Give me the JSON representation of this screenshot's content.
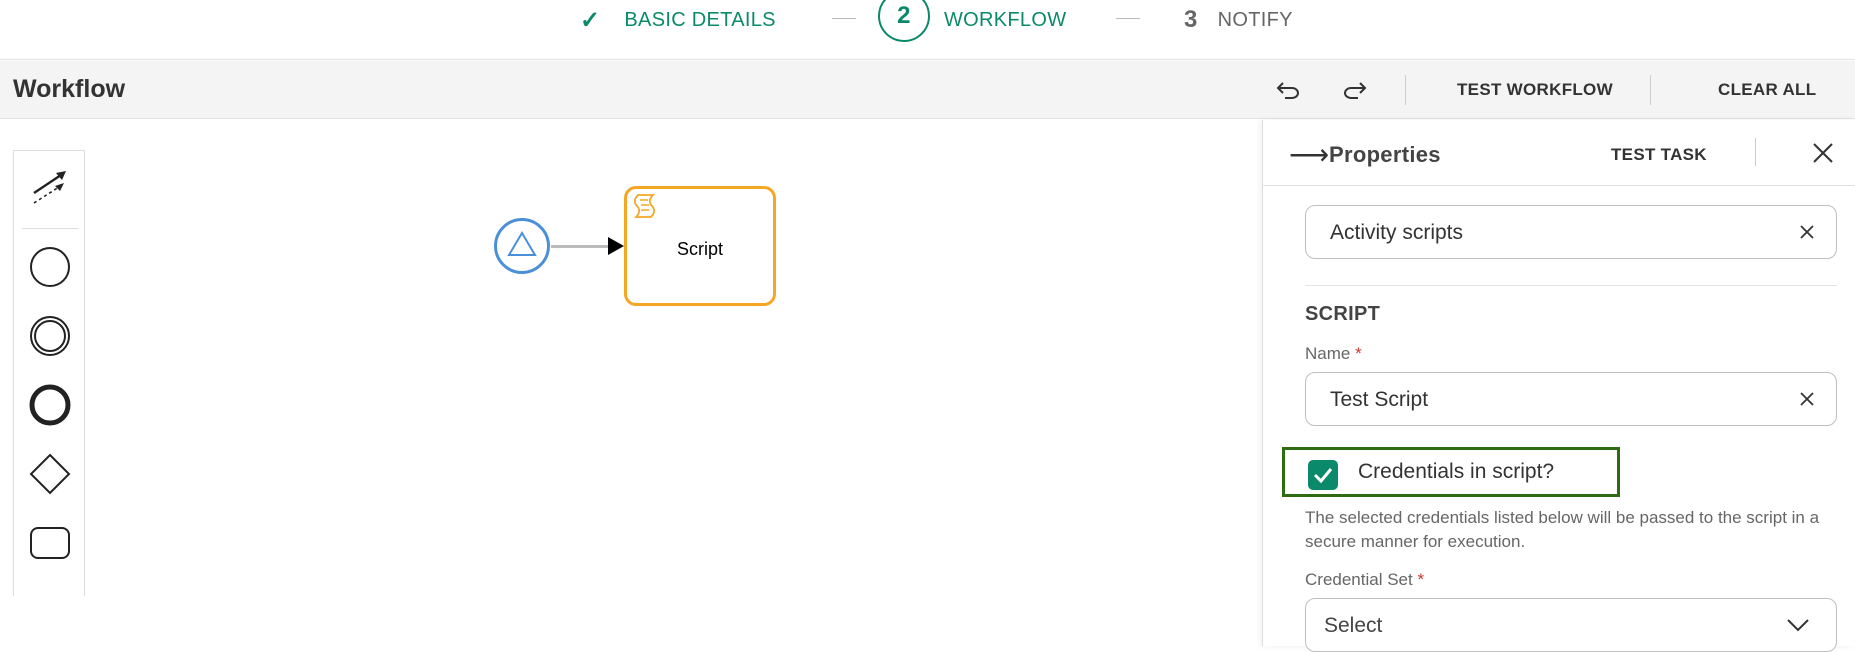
{
  "stepper": {
    "steps": [
      {
        "label": "BASIC DETAILS",
        "state": "done"
      },
      {
        "number": "2",
        "label": "WORKFLOW",
        "state": "active"
      },
      {
        "number": "3",
        "label": "NOTIFY",
        "state": "idle"
      }
    ]
  },
  "header": {
    "title": "Workflow",
    "undo_icon": "undo-icon",
    "redo_icon": "redo-icon",
    "test_workflow": "TEST WORKFLOW",
    "clear_all": "CLEAR ALL"
  },
  "palette": {
    "items": [
      "connect-tool-icon",
      "start-event-icon",
      "intermediate-event-icon",
      "end-event-icon",
      "gateway-icon",
      "task-icon"
    ]
  },
  "diagram": {
    "script_task_label": "Script"
  },
  "properties": {
    "title": "Properties",
    "test_task": "TEST TASK",
    "type_value": "Activity scripts",
    "section_title": "SCRIPT",
    "name_label": "Name",
    "name_required": "*",
    "name_value": "Test Script",
    "credentials_checkbox_label": "Credentials in script?",
    "credentials_checked": true,
    "credentials_help": "The selected credentials listed below will be passed to the script in a secure manner for execution.",
    "credential_set_label": "Credential Set",
    "credential_set_required": "*",
    "credential_set_value": "Select"
  },
  "colors": {
    "accent": "#0a8a6a",
    "script_border": "#f5a623",
    "start_event": "#4a90d9",
    "checkbox_highlight": "#2e6b12",
    "required": "#d0342c"
  }
}
